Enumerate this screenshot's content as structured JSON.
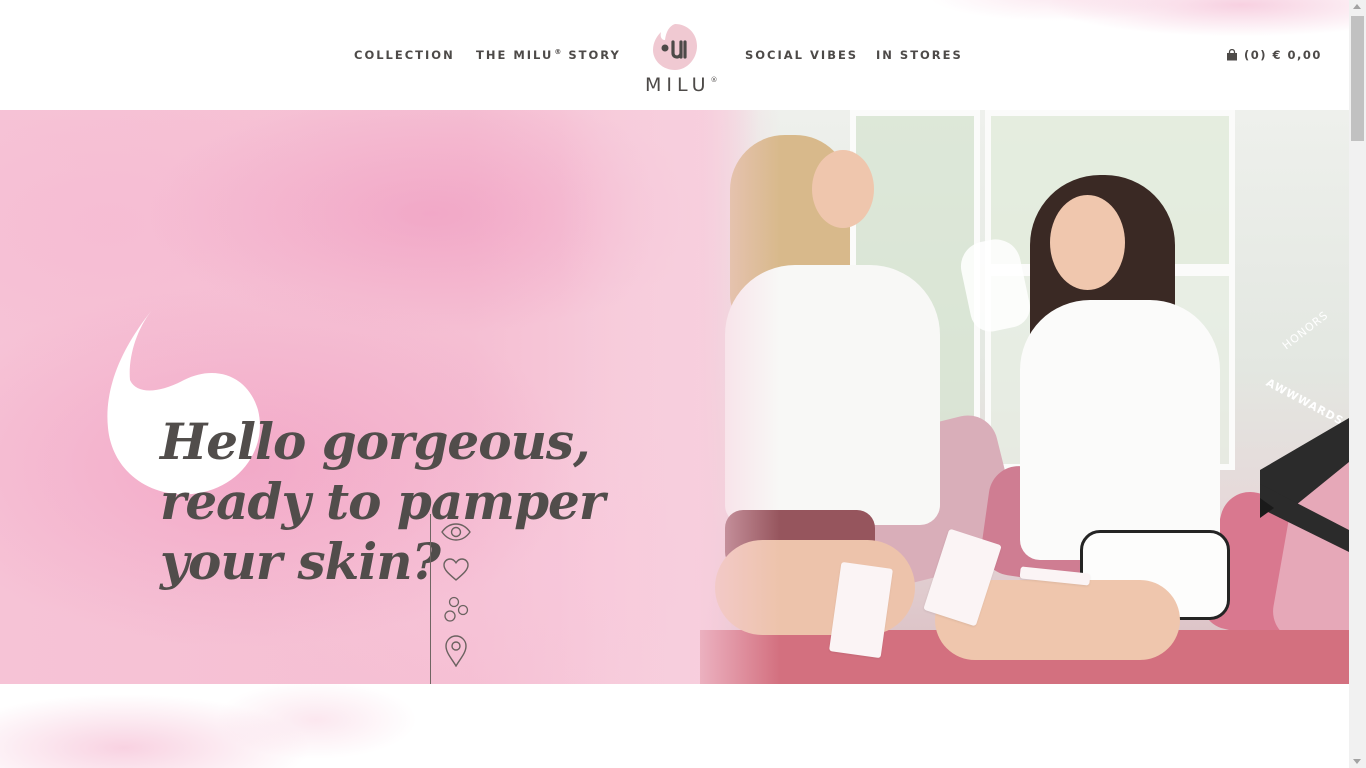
{
  "nav": {
    "collection": "COLLECTION",
    "story_prefix": "THE MILU",
    "story_reg": "®",
    "story_suffix": "STORY",
    "social": "SOCIAL VIBES",
    "stores": "IN STORES"
  },
  "logo": {
    "text": "MILU",
    "reg": "®",
    "icon": "milu-drop-logo-icon"
  },
  "cart": {
    "icon": "shopping-bag-icon",
    "label": "(0) € 0,00"
  },
  "hero": {
    "headline": [
      "Hello gorgeous,",
      "ready to pamper",
      "your skin?"
    ]
  },
  "side_icons": [
    "eye-icon",
    "heart-icon",
    "bubbles-icon",
    "location-pin-icon"
  ],
  "ribbon": {
    "top": "HONORS",
    "bottom": "AWWWARDS"
  },
  "colors": {
    "text": "#4d4a48",
    "pink": "#f5bfd3",
    "logo_pink": "#f0c9d2",
    "ribbon": "#2b2b2b",
    "ribbon_accent": "#49c5b6"
  }
}
